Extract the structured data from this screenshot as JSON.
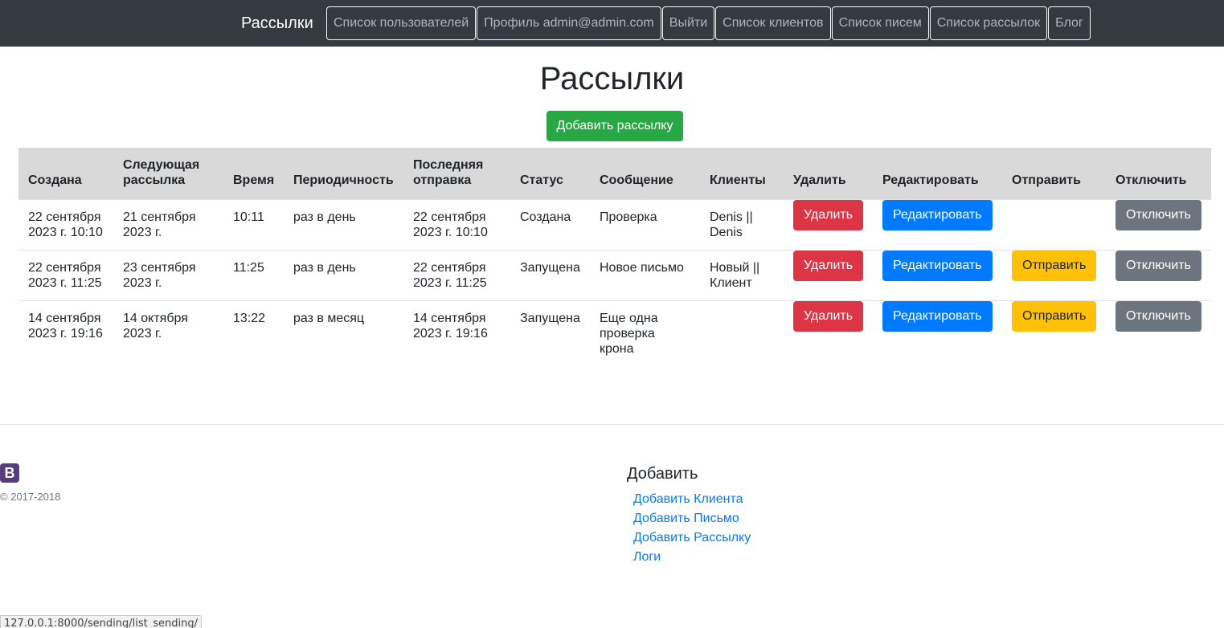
{
  "navbar": {
    "brand": "Рассылки",
    "links": [
      "Список пользователей",
      "Профиль admin@admin.com",
      "Выйти",
      "Список клиентов",
      "Список писем",
      "Список рассылок",
      "Блог"
    ]
  },
  "page": {
    "title": "Рассылки",
    "add_button": "Добавить рассылку"
  },
  "table": {
    "headers": {
      "created": "Создана",
      "next": "Следующая рассылка",
      "time": "Время",
      "period": "Периодичность",
      "last": "Последняя отправка",
      "status": "Статус",
      "message": "Сообщение",
      "clients": "Клиенты",
      "delete": "Удалить",
      "edit": "Редактировать",
      "send": "Отправить",
      "disable": "Отключить"
    },
    "rows": [
      {
        "created": "22 сентября 2023 г. 10:10",
        "next": "21 сентября 2023 г.",
        "time": "10:11",
        "period": "раз в день",
        "last": "22 сентября 2023 г. 10:10",
        "status": "Создана",
        "message": "Проверка",
        "clients": "Denis || Denis",
        "delete": "Удалить",
        "edit": "Редактировать",
        "send": "",
        "disable": "Отключить"
      },
      {
        "created": "22 сентября 2023 г. 11:25",
        "next": "23 сентября 2023 г.",
        "time": "11:25",
        "period": "раз в день",
        "last": "22 сентября 2023 г. 11:25",
        "status": "Запущена",
        "message": "Новое письмо",
        "clients": "Новый || Клиент",
        "delete": "Удалить",
        "edit": "Редактировать",
        "send": "Отправить",
        "disable": "Отключить"
      },
      {
        "created": "14 сентября 2023 г. 19:16",
        "next": "14 октября 2023 г.",
        "time": "13:22",
        "period": "раз в месяц",
        "last": "14 сентября 2023 г. 19:16",
        "status": "Запущена",
        "message": "Еще одна проверка крона",
        "clients": "",
        "delete": "Удалить",
        "edit": "Редактировать",
        "send": "Отправить",
        "disable": "Отключить"
      }
    ]
  },
  "footer": {
    "logo_letter": "B",
    "copyright": "© 2017-2018",
    "heading": "Добавить",
    "links": [
      "Добавить Клиента",
      "Добавить Письмо",
      "Добавить Рассылку",
      "Логи"
    ]
  },
  "status_bar": {
    "url": "127.0.0.1:8000/sending/list_sending/"
  },
  "colors": {
    "navbar_bg": "#343a40",
    "success": "#28a745",
    "danger": "#dc3545",
    "primary": "#007bff",
    "warning": "#ffc107",
    "secondary": "#6c757d",
    "table_header_bg": "#d9d9d9"
  }
}
